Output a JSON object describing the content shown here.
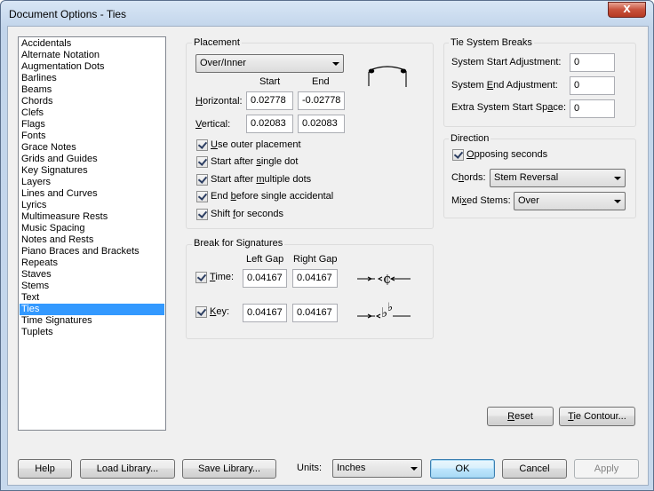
{
  "window": {
    "title": "Document Options - Ties",
    "close_glyph": "x"
  },
  "categories": {
    "items": [
      "Accidentals",
      "Alternate Notation",
      "Augmentation Dots",
      "Barlines",
      "Beams",
      "Chords",
      "Clefs",
      "Flags",
      "Fonts",
      "Grace Notes",
      "Grids and Guides",
      "Key Signatures",
      "Layers",
      "Lines and Curves",
      "Lyrics",
      "Multimeasure Rests",
      "Music Spacing",
      "Notes and Rests",
      "Piano Braces and Brackets",
      "Repeats",
      "Staves",
      "Stems",
      "Text",
      "Ties",
      "Time Signatures",
      "Tuplets"
    ],
    "selected": "Ties"
  },
  "placement": {
    "label": "Placement",
    "mode": "Over/Inner",
    "col_start": "Start",
    "col_end": "End",
    "horizontal_label": "Horizontal:",
    "horizontal_start": "0.02778",
    "horizontal_end": "-0.02778",
    "vertical_label": "Vertical:",
    "vertical_start": "0.02083",
    "vertical_end": "0.02083",
    "checks": [
      {
        "label": "Use outer placement",
        "checked": true
      },
      {
        "label": "Start after single dot",
        "checked": true
      },
      {
        "label": "Start after multiple dots",
        "checked": true
      },
      {
        "label": "End before single accidental",
        "checked": true
      },
      {
        "label": "Shift for seconds",
        "checked": true
      }
    ]
  },
  "break_signatures": {
    "label": "Break for Signatures",
    "col_left": "Left Gap",
    "col_right": "Right Gap",
    "time_label": "Time:",
    "time_checked": true,
    "time_left": "0.04167",
    "time_right": "0.04167",
    "key_label": "Key:",
    "key_checked": true,
    "key_left": "0.04167",
    "key_right": "0.04167"
  },
  "system_breaks": {
    "label": "Tie System Breaks",
    "start_label": "System Start Adjustment:",
    "start_value": "0",
    "end_label": "System End Adjustment:",
    "end_value": "0",
    "extra_label": "Extra System Start Space:",
    "extra_value": "0"
  },
  "direction": {
    "label": "Direction",
    "opposing_label": "Opposing seconds",
    "opposing_checked": true,
    "chords_label": "Chords:",
    "chords_value": "Stem Reversal",
    "mixed_label": "Mixed Stems:",
    "mixed_value": "Over"
  },
  "buttons": {
    "reset": "Reset",
    "tie_contour": "Tie Contour...",
    "help": "Help",
    "load_library": "Load Library...",
    "save_library": "Save Library...",
    "units_label": "Units:",
    "units_value": "Inches",
    "ok": "OK",
    "cancel": "Cancel",
    "apply": "Apply"
  }
}
